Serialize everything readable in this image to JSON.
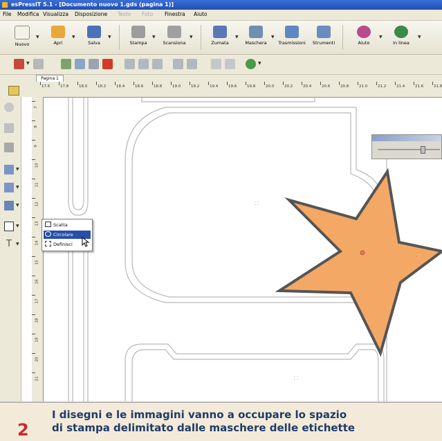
{
  "window": {
    "title": "esPressIT 5.1 - [Documento nuovo 1.gds (pagina 1)]"
  },
  "menu": [
    {
      "label": "File",
      "disabled": false
    },
    {
      "label": "Modifica",
      "disabled": false
    },
    {
      "label": "Visualizza",
      "disabled": false
    },
    {
      "label": "Disposizione",
      "disabled": false
    },
    {
      "label": "Testo",
      "disabled": true
    },
    {
      "label": "Foto",
      "disabled": true
    },
    {
      "label": "Finestra",
      "disabled": false
    },
    {
      "label": "Aiuto",
      "disabled": false
    }
  ],
  "toolbar": {
    "buttons": [
      {
        "label": "Nuovo",
        "icon": "new-document-icon",
        "color": "#e9e6d6"
      },
      {
        "label": "Apri",
        "icon": "open-folder-icon",
        "color": "#e8a83a"
      },
      {
        "label": "Salva",
        "icon": "save-disk-icon",
        "color": "#4a72b8"
      },
      {
        "label": "Stampa",
        "icon": "printer-icon",
        "color": "#9c9c9c"
      },
      {
        "label": "Scansiona",
        "icon": "scanner-icon",
        "color": "#a0a0a0"
      },
      {
        "label": "Zumata",
        "icon": "zoom-icon",
        "color": "#5a78b8"
      },
      {
        "label": "Maschera",
        "icon": "mask-icon",
        "color": "#6f8fb0"
      },
      {
        "label": "Trasmissioni",
        "icon": "transmit-icon",
        "color": "#5f88c0"
      },
      {
        "label": "Strumenti",
        "icon": "tools-icon",
        "color": "#6b8cc0"
      },
      {
        "label": "Aiuto",
        "icon": "help-icon",
        "color": "#b84a8e"
      },
      {
        "label": "In linea",
        "icon": "online-globe-icon",
        "color": "#3a8a4a"
      }
    ]
  },
  "tabs": [
    {
      "label": "Pagina 1"
    }
  ],
  "ruler": {
    "h_labels": [
      "17.6",
      "17.8",
      "18.0",
      "18.2",
      "18.4",
      "18.6",
      "18.8",
      "19.0",
      "19.2",
      "19.4",
      "19.6",
      "19.8",
      "20.0",
      "20.2",
      "20.4",
      "20.6",
      "20.8",
      "21.0",
      "21.2",
      "21.4",
      "21.6",
      "21.8"
    ],
    "v_labels": [
      "7",
      "8",
      "9",
      "10",
      "11",
      "12",
      "13",
      "14",
      "15",
      "16",
      "17",
      "18",
      "19",
      "20",
      "21"
    ]
  },
  "popup": {
    "items": [
      {
        "label": "Scatta",
        "icon": "frame-icon",
        "selected": false
      },
      {
        "label": "Circolare",
        "icon": "circle-shape-icon",
        "selected": true
      },
      {
        "label": "Definisci",
        "icon": "define-shape-icon",
        "selected": false
      }
    ]
  },
  "canvas": {
    "star_color": "#f3a865",
    "star_outline": "#555555"
  },
  "caption": {
    "number": "2",
    "line1": "I disegni e le immagini vanno a occupare lo spazio",
    "line2": "di stampa delimitato dalle maschere delle etichette"
  }
}
